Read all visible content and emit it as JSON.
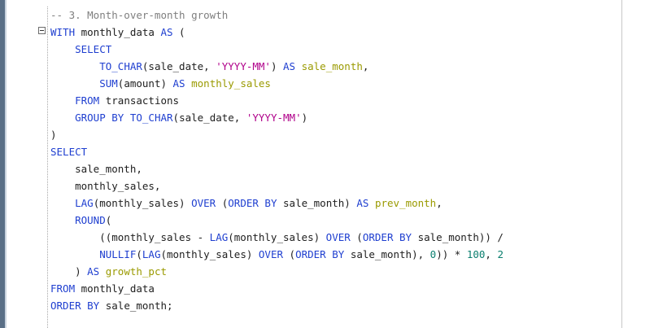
{
  "editor": {
    "code_lines": [
      [
        {
          "t": "-- 3. Month-over-month growth",
          "c": "cm"
        }
      ],
      [
        {
          "t": "WITH",
          "c": "kw"
        },
        {
          "t": " monthly_data ",
          "c": "pl"
        },
        {
          "t": "AS",
          "c": "kw"
        },
        {
          "t": " (",
          "c": "pl"
        }
      ],
      [
        {
          "t": "    ",
          "c": "pl"
        },
        {
          "t": "SELECT",
          "c": "kw"
        }
      ],
      [
        {
          "t": "        ",
          "c": "pl"
        },
        {
          "t": "TO_CHAR",
          "c": "fn"
        },
        {
          "t": "(sale_date, ",
          "c": "pl"
        },
        {
          "t": "'YYYY-MM'",
          "c": "str"
        },
        {
          "t": ") ",
          "c": "pl"
        },
        {
          "t": "AS",
          "c": "kw"
        },
        {
          "t": " ",
          "c": "pl"
        },
        {
          "t": "sale_month",
          "c": "al"
        },
        {
          "t": ",",
          "c": "pl"
        }
      ],
      [
        {
          "t": "        ",
          "c": "pl"
        },
        {
          "t": "SUM",
          "c": "fn"
        },
        {
          "t": "(amount) ",
          "c": "pl"
        },
        {
          "t": "AS",
          "c": "kw"
        },
        {
          "t": " ",
          "c": "pl"
        },
        {
          "t": "monthly_sales",
          "c": "al"
        }
      ],
      [
        {
          "t": "    ",
          "c": "pl"
        },
        {
          "t": "FROM",
          "c": "kw"
        },
        {
          "t": " transactions",
          "c": "pl"
        }
      ],
      [
        {
          "t": "    ",
          "c": "pl"
        },
        {
          "t": "GROUP BY",
          "c": "kw"
        },
        {
          "t": " ",
          "c": "pl"
        },
        {
          "t": "TO_CHAR",
          "c": "fn"
        },
        {
          "t": "(sale_date, ",
          "c": "pl"
        },
        {
          "t": "'YYYY-MM'",
          "c": "str"
        },
        {
          "t": ")",
          "c": "pl"
        }
      ],
      [
        {
          "t": ")",
          "c": "pl"
        }
      ],
      [
        {
          "t": "SELECT",
          "c": "kw"
        }
      ],
      [
        {
          "t": "    sale_month,",
          "c": "pl"
        }
      ],
      [
        {
          "t": "    monthly_sales,",
          "c": "pl"
        }
      ],
      [
        {
          "t": "    ",
          "c": "pl"
        },
        {
          "t": "LAG",
          "c": "fn"
        },
        {
          "t": "(monthly_sales) ",
          "c": "pl"
        },
        {
          "t": "OVER",
          "c": "kw"
        },
        {
          "t": " (",
          "c": "pl"
        },
        {
          "t": "ORDER BY",
          "c": "kw"
        },
        {
          "t": " sale_month) ",
          "c": "pl"
        },
        {
          "t": "AS",
          "c": "kw"
        },
        {
          "t": " ",
          "c": "pl"
        },
        {
          "t": "prev_month",
          "c": "al"
        },
        {
          "t": ",",
          "c": "pl"
        }
      ],
      [
        {
          "t": "    ",
          "c": "pl"
        },
        {
          "t": "ROUND",
          "c": "fn"
        },
        {
          "t": "(",
          "c": "pl"
        }
      ],
      [
        {
          "t": "        ((monthly_sales - ",
          "c": "pl"
        },
        {
          "t": "LAG",
          "c": "fn"
        },
        {
          "t": "(monthly_sales) ",
          "c": "pl"
        },
        {
          "t": "OVER",
          "c": "kw"
        },
        {
          "t": " (",
          "c": "pl"
        },
        {
          "t": "ORDER BY",
          "c": "kw"
        },
        {
          "t": " sale_month)) /",
          "c": "pl"
        }
      ],
      [
        {
          "t": "        ",
          "c": "pl"
        },
        {
          "t": "NULLIF",
          "c": "fn"
        },
        {
          "t": "(",
          "c": "pl"
        },
        {
          "t": "LAG",
          "c": "fn"
        },
        {
          "t": "(monthly_sales) ",
          "c": "pl"
        },
        {
          "t": "OVER",
          "c": "kw"
        },
        {
          "t": " (",
          "c": "pl"
        },
        {
          "t": "ORDER BY",
          "c": "kw"
        },
        {
          "t": " sale_month), ",
          "c": "pl"
        },
        {
          "t": "0",
          "c": "num"
        },
        {
          "t": ")) * ",
          "c": "pl"
        },
        {
          "t": "100",
          "c": "num"
        },
        {
          "t": ", ",
          "c": "pl"
        },
        {
          "t": "2",
          "c": "num"
        }
      ],
      [
        {
          "t": "    ) ",
          "c": "pl"
        },
        {
          "t": "AS",
          "c": "kw"
        },
        {
          "t": " ",
          "c": "pl"
        },
        {
          "t": "growth_pct",
          "c": "al"
        }
      ],
      [
        {
          "t": "FROM",
          "c": "kw"
        },
        {
          "t": " monthly_data",
          "c": "pl"
        }
      ],
      [
        {
          "t": "ORDER BY",
          "c": "kw"
        },
        {
          "t": " sale_month;",
          "c": "pl"
        }
      ]
    ]
  }
}
